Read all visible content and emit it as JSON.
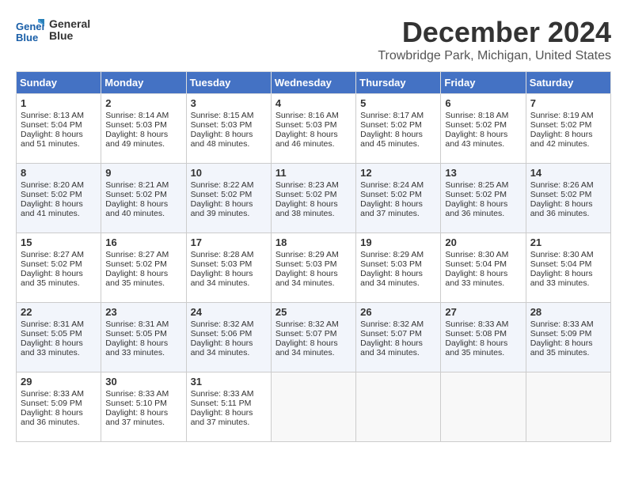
{
  "header": {
    "logo_line1": "General",
    "logo_line2": "Blue",
    "month": "December 2024",
    "location": "Trowbridge Park, Michigan, United States"
  },
  "weekdays": [
    "Sunday",
    "Monday",
    "Tuesday",
    "Wednesday",
    "Thursday",
    "Friday",
    "Saturday"
  ],
  "weeks": [
    [
      {
        "day": "1",
        "sunrise": "Sunrise: 8:13 AM",
        "sunset": "Sunset: 5:04 PM",
        "daylight": "Daylight: 8 hours and 51 minutes."
      },
      {
        "day": "2",
        "sunrise": "Sunrise: 8:14 AM",
        "sunset": "Sunset: 5:03 PM",
        "daylight": "Daylight: 8 hours and 49 minutes."
      },
      {
        "day": "3",
        "sunrise": "Sunrise: 8:15 AM",
        "sunset": "Sunset: 5:03 PM",
        "daylight": "Daylight: 8 hours and 48 minutes."
      },
      {
        "day": "4",
        "sunrise": "Sunrise: 8:16 AM",
        "sunset": "Sunset: 5:03 PM",
        "daylight": "Daylight: 8 hours and 46 minutes."
      },
      {
        "day": "5",
        "sunrise": "Sunrise: 8:17 AM",
        "sunset": "Sunset: 5:02 PM",
        "daylight": "Daylight: 8 hours and 45 minutes."
      },
      {
        "day": "6",
        "sunrise": "Sunrise: 8:18 AM",
        "sunset": "Sunset: 5:02 PM",
        "daylight": "Daylight: 8 hours and 43 minutes."
      },
      {
        "day": "7",
        "sunrise": "Sunrise: 8:19 AM",
        "sunset": "Sunset: 5:02 PM",
        "daylight": "Daylight: 8 hours and 42 minutes."
      }
    ],
    [
      {
        "day": "8",
        "sunrise": "Sunrise: 8:20 AM",
        "sunset": "Sunset: 5:02 PM",
        "daylight": "Daylight: 8 hours and 41 minutes."
      },
      {
        "day": "9",
        "sunrise": "Sunrise: 8:21 AM",
        "sunset": "Sunset: 5:02 PM",
        "daylight": "Daylight: 8 hours and 40 minutes."
      },
      {
        "day": "10",
        "sunrise": "Sunrise: 8:22 AM",
        "sunset": "Sunset: 5:02 PM",
        "daylight": "Daylight: 8 hours and 39 minutes."
      },
      {
        "day": "11",
        "sunrise": "Sunrise: 8:23 AM",
        "sunset": "Sunset: 5:02 PM",
        "daylight": "Daylight: 8 hours and 38 minutes."
      },
      {
        "day": "12",
        "sunrise": "Sunrise: 8:24 AM",
        "sunset": "Sunset: 5:02 PM",
        "daylight": "Daylight: 8 hours and 37 minutes."
      },
      {
        "day": "13",
        "sunrise": "Sunrise: 8:25 AM",
        "sunset": "Sunset: 5:02 PM",
        "daylight": "Daylight: 8 hours and 36 minutes."
      },
      {
        "day": "14",
        "sunrise": "Sunrise: 8:26 AM",
        "sunset": "Sunset: 5:02 PM",
        "daylight": "Daylight: 8 hours and 36 minutes."
      }
    ],
    [
      {
        "day": "15",
        "sunrise": "Sunrise: 8:27 AM",
        "sunset": "Sunset: 5:02 PM",
        "daylight": "Daylight: 8 hours and 35 minutes."
      },
      {
        "day": "16",
        "sunrise": "Sunrise: 8:27 AM",
        "sunset": "Sunset: 5:02 PM",
        "daylight": "Daylight: 8 hours and 35 minutes."
      },
      {
        "day": "17",
        "sunrise": "Sunrise: 8:28 AM",
        "sunset": "Sunset: 5:03 PM",
        "daylight": "Daylight: 8 hours and 34 minutes."
      },
      {
        "day": "18",
        "sunrise": "Sunrise: 8:29 AM",
        "sunset": "Sunset: 5:03 PM",
        "daylight": "Daylight: 8 hours and 34 minutes."
      },
      {
        "day": "19",
        "sunrise": "Sunrise: 8:29 AM",
        "sunset": "Sunset: 5:03 PM",
        "daylight": "Daylight: 8 hours and 34 minutes."
      },
      {
        "day": "20",
        "sunrise": "Sunrise: 8:30 AM",
        "sunset": "Sunset: 5:04 PM",
        "daylight": "Daylight: 8 hours and 33 minutes."
      },
      {
        "day": "21",
        "sunrise": "Sunrise: 8:30 AM",
        "sunset": "Sunset: 5:04 PM",
        "daylight": "Daylight: 8 hours and 33 minutes."
      }
    ],
    [
      {
        "day": "22",
        "sunrise": "Sunrise: 8:31 AM",
        "sunset": "Sunset: 5:05 PM",
        "daylight": "Daylight: 8 hours and 33 minutes."
      },
      {
        "day": "23",
        "sunrise": "Sunrise: 8:31 AM",
        "sunset": "Sunset: 5:05 PM",
        "daylight": "Daylight: 8 hours and 33 minutes."
      },
      {
        "day": "24",
        "sunrise": "Sunrise: 8:32 AM",
        "sunset": "Sunset: 5:06 PM",
        "daylight": "Daylight: 8 hours and 34 minutes."
      },
      {
        "day": "25",
        "sunrise": "Sunrise: 8:32 AM",
        "sunset": "Sunset: 5:07 PM",
        "daylight": "Daylight: 8 hours and 34 minutes."
      },
      {
        "day": "26",
        "sunrise": "Sunrise: 8:32 AM",
        "sunset": "Sunset: 5:07 PM",
        "daylight": "Daylight: 8 hours and 34 minutes."
      },
      {
        "day": "27",
        "sunrise": "Sunrise: 8:33 AM",
        "sunset": "Sunset: 5:08 PM",
        "daylight": "Daylight: 8 hours and 35 minutes."
      },
      {
        "day": "28",
        "sunrise": "Sunrise: 8:33 AM",
        "sunset": "Sunset: 5:09 PM",
        "daylight": "Daylight: 8 hours and 35 minutes."
      }
    ],
    [
      {
        "day": "29",
        "sunrise": "Sunrise: 8:33 AM",
        "sunset": "Sunset: 5:09 PM",
        "daylight": "Daylight: 8 hours and 36 minutes."
      },
      {
        "day": "30",
        "sunrise": "Sunrise: 8:33 AM",
        "sunset": "Sunset: 5:10 PM",
        "daylight": "Daylight: 8 hours and 37 minutes."
      },
      {
        "day": "31",
        "sunrise": "Sunrise: 8:33 AM",
        "sunset": "Sunset: 5:11 PM",
        "daylight": "Daylight: 8 hours and 37 minutes."
      },
      null,
      null,
      null,
      null
    ]
  ]
}
